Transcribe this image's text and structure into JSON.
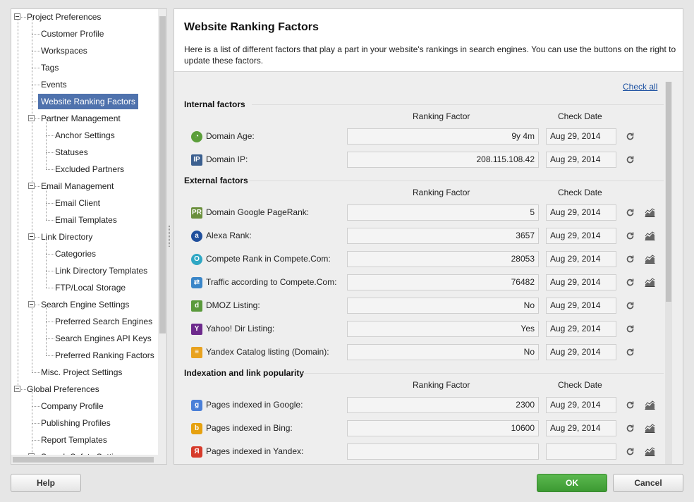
{
  "tree": {
    "items": [
      {
        "label": "Project Preferences"
      },
      {
        "label": "Customer Profile"
      },
      {
        "label": "Workspaces"
      },
      {
        "label": "Tags"
      },
      {
        "label": "Events"
      },
      {
        "label": "Website Ranking Factors",
        "selected": true
      },
      {
        "label": "Partner Management"
      },
      {
        "label": "Anchor Settings"
      },
      {
        "label": "Statuses"
      },
      {
        "label": "Excluded Partners"
      },
      {
        "label": "Email Management"
      },
      {
        "label": "Email Client"
      },
      {
        "label": "Email Templates"
      },
      {
        "label": "Link Directory"
      },
      {
        "label": "Categories"
      },
      {
        "label": "Link Directory Templates"
      },
      {
        "label": "FTP/Local Storage"
      },
      {
        "label": "Search Engine Settings"
      },
      {
        "label": "Preferred Search Engines"
      },
      {
        "label": "Search Engines API Keys"
      },
      {
        "label": "Preferred Ranking Factors"
      },
      {
        "label": "Misc. Project Settings"
      },
      {
        "label": "Global Preferences"
      },
      {
        "label": "Company Profile"
      },
      {
        "label": "Publishing Profiles"
      },
      {
        "label": "Report Templates"
      },
      {
        "label": "Search Safety Settings"
      }
    ]
  },
  "header": {
    "title": "Website Ranking Factors",
    "description": "Here is a list of different factors that play a part in your website's rankings in search engines. You can use the buttons on the right to update these factors."
  },
  "check_all": "Check all",
  "columns": {
    "ranking": "Ranking Factor",
    "date": "Check Date"
  },
  "sections": [
    {
      "title": "Internal factors",
      "rows": [
        {
          "icon": "domain-age-icon",
          "name": "Domain Age:",
          "value": "9y 4m",
          "date": "Aug 29, 2014",
          "chart": false
        },
        {
          "icon": "ip-icon",
          "name": "Domain IP:",
          "value": "208.115.108.42",
          "date": "Aug 29, 2014",
          "chart": false
        }
      ]
    },
    {
      "title": "External factors",
      "rows": [
        {
          "icon": "pagerank-icon",
          "name": "Domain Google PageRank:",
          "value": "5",
          "date": "Aug 29, 2014",
          "chart": true
        },
        {
          "icon": "alexa-icon",
          "name": "Alexa Rank:",
          "value": "3657",
          "date": "Aug 29, 2014",
          "chart": true
        },
        {
          "icon": "compete-icon",
          "name": "Compete Rank in Compete.Com:",
          "value": "28053",
          "date": "Aug 29, 2014",
          "chart": true
        },
        {
          "icon": "traffic-icon",
          "name": "Traffic according to Compete.Com:",
          "value": "76482",
          "date": "Aug 29, 2014",
          "chart": true
        },
        {
          "icon": "dmoz-icon",
          "name": "DMOZ Listing:",
          "value": "No",
          "date": "Aug 29, 2014",
          "chart": false
        },
        {
          "icon": "yahoo-icon",
          "name": "Yahoo! Dir Listing:",
          "value": "Yes",
          "date": "Aug 29, 2014",
          "chart": false
        },
        {
          "icon": "yandex-catalog-icon",
          "name": "Yandex Catalog listing (Domain):",
          "value": "No",
          "date": "Aug 29, 2014",
          "chart": false
        }
      ]
    },
    {
      "title": "Indexation and link popularity",
      "rows": [
        {
          "icon": "google-icon",
          "name": "Pages indexed in Google:",
          "value": "2300",
          "date": "Aug 29, 2014",
          "chart": true
        },
        {
          "icon": "bing-icon",
          "name": "Pages indexed in Bing:",
          "value": "10600",
          "date": "Aug 29, 2014",
          "chart": true
        },
        {
          "icon": "yandex-icon",
          "name": "Pages indexed in Yandex:",
          "value": "",
          "date": "",
          "chart": true
        }
      ]
    }
  ],
  "buttons": {
    "help": "Help",
    "ok": "OK",
    "cancel": "Cancel"
  },
  "colors": {
    "selection": "#4f72ad",
    "ok_button": "#4aa83e",
    "link": "#1a4fa0"
  }
}
